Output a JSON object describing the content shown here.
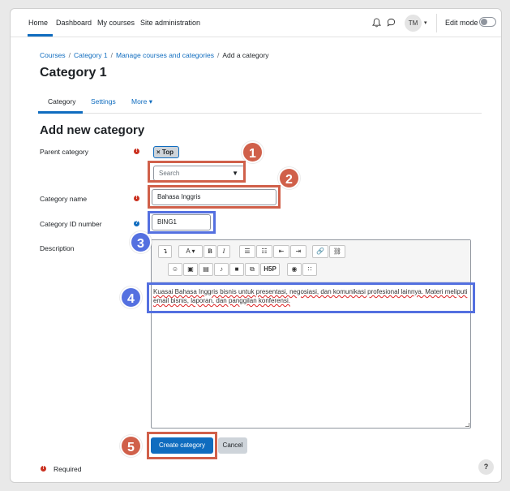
{
  "navbar": {
    "items": [
      "Home",
      "Dashboard",
      "My courses",
      "Site administration"
    ],
    "user_initials": "TM",
    "edit_mode_label": "Edit mode"
  },
  "breadcrumb": [
    "Courses",
    "Category 1",
    "Manage courses and categories",
    "Add a category"
  ],
  "page_title": "Category 1",
  "tabs": {
    "category": "Category",
    "settings": "Settings",
    "more": "More ▾"
  },
  "form": {
    "title": "Add new category",
    "parent_label": "Parent category",
    "parent_tag": "× Top",
    "parent_search": "Search",
    "name_label": "Category name",
    "name_value": "Bahasa Inggris",
    "idnumber_label": "Category ID number",
    "idnumber_value": "BING1",
    "description_label": "Description",
    "description_text": "Kuasai Bahasa Inggris bisnis untuk presentasi, negosiasi, dan komunikasi profesional lainnya. Materi meliputi email bisnis, laporan, dan panggilan konferensi.",
    "submit_label": "Create category",
    "cancel_label": "Cancel",
    "required_note": "Required"
  },
  "toolbar": {
    "row1": [
      "↴",
      "A ▾",
      "B",
      "I",
      "☰",
      "☷",
      "⇤",
      "⇥",
      "🔗",
      "⛓"
    ],
    "row2": [
      "☺",
      "▣",
      "▤",
      "♪",
      "■",
      "⧉",
      "H5P",
      "◉",
      "∷"
    ]
  },
  "help_fab": "?",
  "annotations": {
    "labels": [
      "1",
      "2",
      "3",
      "4",
      "5"
    ],
    "colors": {
      "red": "#d0604a",
      "blue": "#5470e0"
    }
  },
  "colors": {
    "primary": "#0f6cbf",
    "danger": "#ca3120"
  }
}
